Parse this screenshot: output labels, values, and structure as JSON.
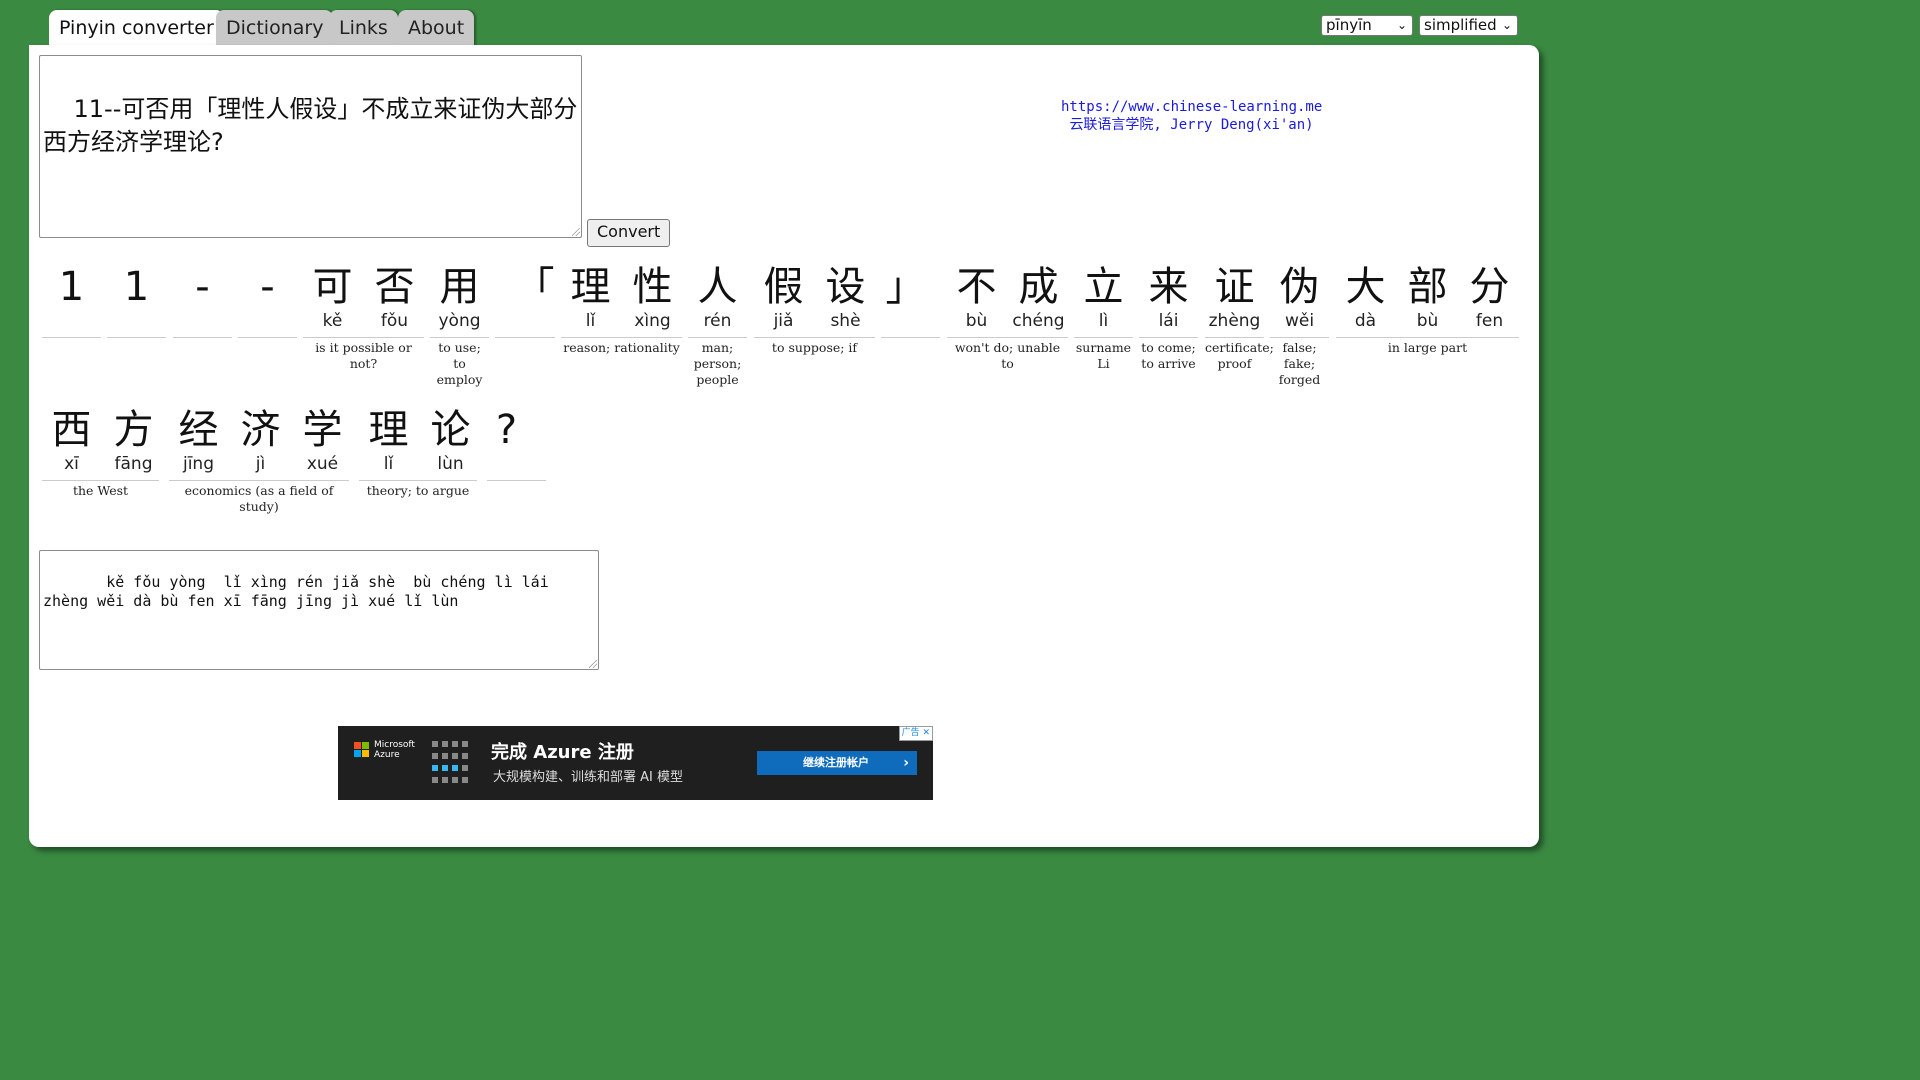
{
  "tabs": [
    {
      "label": "Pinyin converter",
      "active": true
    },
    {
      "label": "Dictionary",
      "active": false
    },
    {
      "label": "Links",
      "active": false
    },
    {
      "label": "About",
      "active": false
    }
  ],
  "selectors": {
    "romanization": "pīnyīn",
    "script": "simplified"
  },
  "input_text": "11--可否用「理性人假设」不成立来证伪大部分西方经济学理论?",
  "convert_label": "Convert",
  "site_info": {
    "url": "https://www.chinese-learning.me",
    "credit": "云联语言学院, Jerry Deng(xi'an)"
  },
  "rows": [
    [
      {
        "han": "1",
        "py": ""
      },
      {
        "han": "1",
        "py": ""
      },
      {
        "han": "-",
        "py": ""
      },
      {
        "han": "-",
        "py": ""
      },
      {
        "han": "可",
        "py": "kě"
      },
      {
        "han": "否",
        "py": "fǒu"
      },
      {
        "han": "用",
        "py": "yòng"
      },
      {
        "han": "「",
        "py": ""
      },
      {
        "han": "理",
        "py": "lǐ"
      },
      {
        "han": "性",
        "py": "xìng"
      },
      {
        "han": "人",
        "py": "rén"
      },
      {
        "han": "假",
        "py": "jiǎ"
      },
      {
        "han": "设",
        "py": "shè"
      },
      {
        "han": "」",
        "py": ""
      },
      {
        "han": "不",
        "py": "bù"
      },
      {
        "han": "成",
        "py": "chéng"
      },
      {
        "han": "立",
        "py": "lì"
      },
      {
        "han": "来",
        "py": "lái"
      },
      {
        "han": "证",
        "py": "zhèng"
      },
      {
        "han": "伪",
        "py": "wěi"
      },
      {
        "han": "大",
        "py": "dà"
      },
      {
        "han": "部",
        "py": "bù"
      },
      {
        "han": "分",
        "py": "fen"
      }
    ],
    [
      {
        "han": "西",
        "py": "xī"
      },
      {
        "han": "方",
        "py": "fāng"
      },
      {
        "han": "经",
        "py": "jīng"
      },
      {
        "han": "济",
        "py": "jì"
      },
      {
        "han": "学",
        "py": "xué"
      },
      {
        "han": "理",
        "py": "lǐ"
      },
      {
        "han": "论",
        "py": "lùn"
      },
      {
        "han": "?",
        "py": ""
      }
    ]
  ],
  "glosses": [
    [
      {
        "text": ""
      },
      {
        "text": ""
      },
      {
        "text": ""
      },
      {
        "text": ""
      },
      {
        "text": "is it possible or not?"
      },
      {
        "text": "to use; to employ"
      },
      {
        "text": ""
      },
      {
        "text": "reason; rationality"
      },
      {
        "text": "man; person; people"
      },
      {
        "text": "to suppose; if"
      },
      {
        "text": ""
      },
      {
        "text": "won't do; unable to"
      },
      {
        "text": "surname Li"
      },
      {
        "text": "to come; to arrive"
      },
      {
        "text": "certificate; proof"
      },
      {
        "text": "false; fake; forged"
      },
      {
        "text": "in large part"
      }
    ],
    [
      {
        "text": "the West"
      },
      {
        "text": "economics (as a field of study)"
      },
      {
        "text": "theory; to argue"
      },
      {
        "text": ""
      }
    ]
  ],
  "output_text": "   kě fǒu yòng  lǐ xìng rén jiǎ shè  bù chéng lì lái zhèng wěi dà bù fen xī fāng jīng jì xué lǐ lùn ",
  "ad": {
    "brand_line1": "Microsoft",
    "brand_line2": "Azure",
    "headline": "完成 Azure 注册",
    "subline": "大规模构建、训练和部署 AI 模型",
    "cta": "继续注册帐户",
    "badge": "广告",
    "colors": {
      "background": "#1f1f1f",
      "cta": "#0f6cbd"
    }
  },
  "colors": {
    "page_bg": "#3a8a42",
    "link": "#1a1adc"
  }
}
